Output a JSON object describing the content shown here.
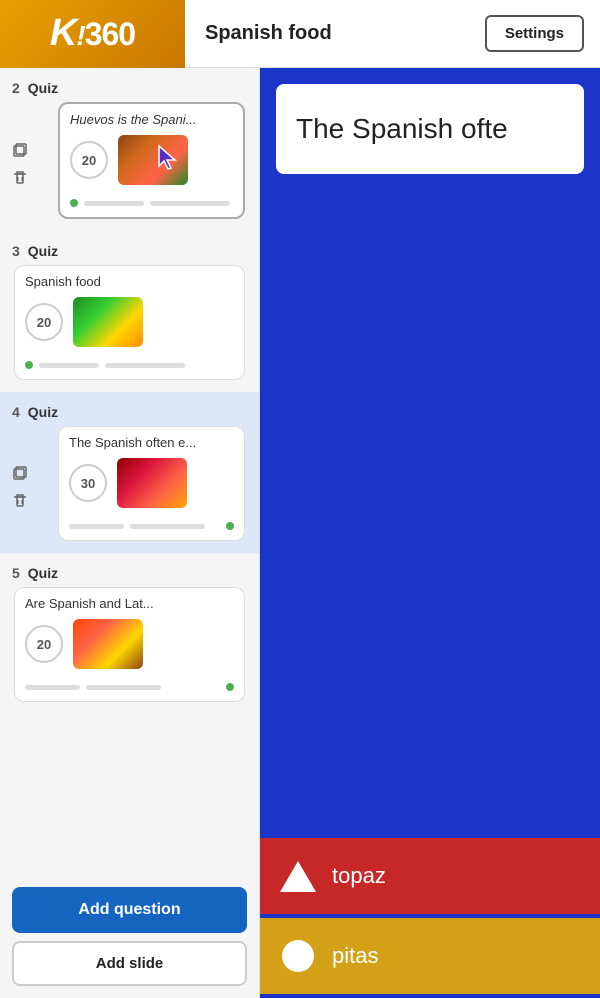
{
  "header": {
    "logo": "K!360",
    "title": "Spanish food",
    "settings_label": "Settings"
  },
  "sidebar": {
    "sections": [
      {
        "id": 2,
        "type": "Quiz",
        "card": {
          "title": "Huevos is the Spani...",
          "italic": true,
          "points": 20,
          "has_cursor": true
        },
        "selected": true,
        "active": false
      },
      {
        "id": 3,
        "type": "Quiz",
        "card": {
          "title": "Spanish food",
          "italic": false,
          "points": 20,
          "has_cursor": false
        },
        "selected": false,
        "active": false
      },
      {
        "id": 4,
        "type": "Quiz",
        "card": {
          "title": "The Spanish often e...",
          "italic": false,
          "points": 30,
          "has_cursor": false
        },
        "selected": false,
        "active": true
      },
      {
        "id": 5,
        "type": "Quiz",
        "card": {
          "title": "Are Spanish and Lat...",
          "italic": false,
          "points": 20,
          "has_cursor": false
        },
        "selected": false,
        "active": false
      }
    ],
    "add_question_label": "Add question",
    "add_slide_label": "Add slide"
  },
  "main_panel": {
    "question_text": "The Spanish ofte",
    "answers": [
      {
        "shape": "triangle",
        "text": "topaz",
        "color": "red"
      },
      {
        "shape": "circle",
        "text": "pitas",
        "color": "gold"
      }
    ]
  }
}
